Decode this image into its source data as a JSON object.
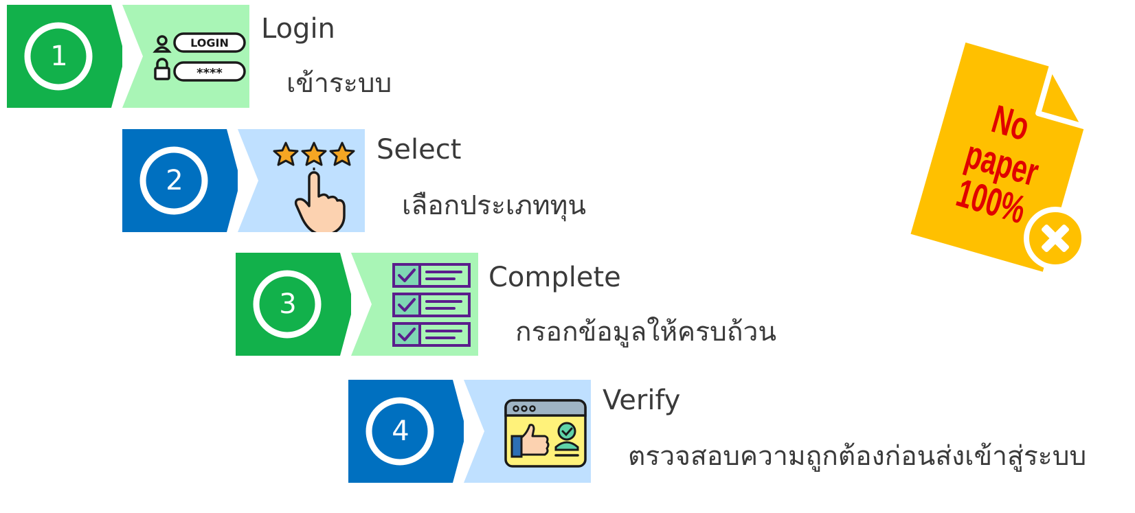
{
  "colors": {
    "green_dark": "#12b14b",
    "green_light": "#a9f5b6",
    "blue_dark": "#0070c0",
    "blue_light": "#bfe0ff",
    "doc_yellow": "#ffc000",
    "doc_text_red": "#e00000",
    "text_gray": "#3a3a3a"
  },
  "steps": [
    {
      "number": "1",
      "title": "Login",
      "subtitle": "เข้าระบบ",
      "icon": "login-form-icon",
      "theme": "green",
      "icon_texts": {
        "login_field": "LOGIN",
        "password_field": "****"
      }
    },
    {
      "number": "2",
      "title": "Select",
      "subtitle": "เลือกประเภททุน",
      "icon": "star-rating-hand-icon",
      "theme": "blue"
    },
    {
      "number": "3",
      "title": "Complete",
      "subtitle": "กรอกข้อมูลให้ครบถ้วน",
      "icon": "checklist-icon",
      "theme": "green"
    },
    {
      "number": "4",
      "title": "Verify",
      "subtitle": "ตรวจสอบความถูกต้องก่อนส่งเข้าสู่ระบบ",
      "icon": "verify-browser-icon",
      "theme": "blue"
    }
  ],
  "no_paper": {
    "line1": "No",
    "line2": "paper",
    "line3": "100%",
    "icon": "no-paper-document-icon"
  }
}
